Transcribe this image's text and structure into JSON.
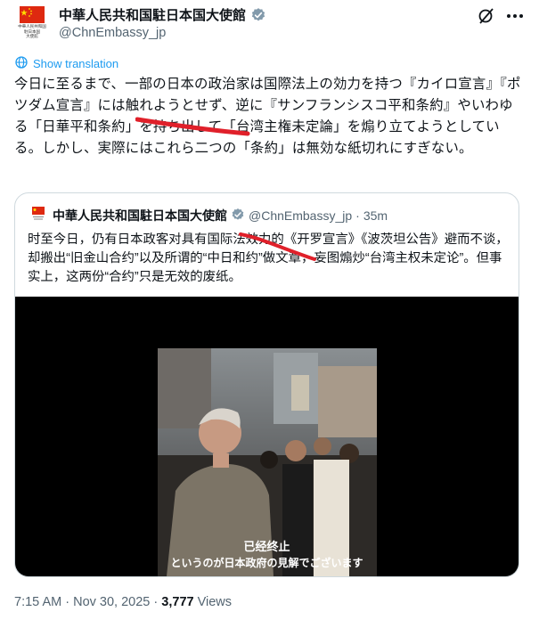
{
  "author": {
    "display_name": "中華人民共和国駐日本国大使館",
    "handle": "@ChnEmbassy_jp",
    "avatar_caption_lines": [
      "中華人民共和国",
      "駐日本国",
      "大使館"
    ]
  },
  "translate_label": "Show translation",
  "tweet_text": "今日に至るまで、一部の日本の政治家は国際法上の効力を持つ『カイロ宣言』『ポツダム宣言』には触れようとせず、逆に『サンフランシスコ平和条約』やいわゆる「日華平和条約」を持ち出して「台湾主権未定論」を煽り立てようとしている。しかし、実際にはこれら二つの「条約」は無効な紙切れにすぎない。",
  "quoted": {
    "display_name": "中華人民共和国駐日本国大使館",
    "handle": "@ChnEmbassy_jp",
    "separator": "·",
    "time_ago": "35m",
    "text": "时至今日，仍有日本政客对具有国际法效力的《开罗宣言》《波茨坦公告》避而不谈，却搬出“旧金山合约”以及所谓的“中日和约”做文章，妄图煽炒“台湾主权未定论”。但事实上，这两份“合约”只是无效的废纸。",
    "video": {
      "subtitle_zh": "已经终止",
      "subtitle_ja": "というのが日本政府の見解でございます"
    }
  },
  "footer": {
    "time": "7:15 AM",
    "sep1": "·",
    "date": "Nov 30, 2025",
    "sep2": "·",
    "views_count": "3,777",
    "views_label": "Views"
  },
  "colors": {
    "accent": "#1d9bf0",
    "flag_red": "#de2910",
    "flag_star": "#ffde00",
    "verified_gray": "#829aab",
    "annotation_red": "#e0202a"
  },
  "icons": [
    "flag-avatar",
    "verified-gray-badge-icon",
    "grok-icon",
    "more-icon",
    "translate-globe-icon"
  ]
}
